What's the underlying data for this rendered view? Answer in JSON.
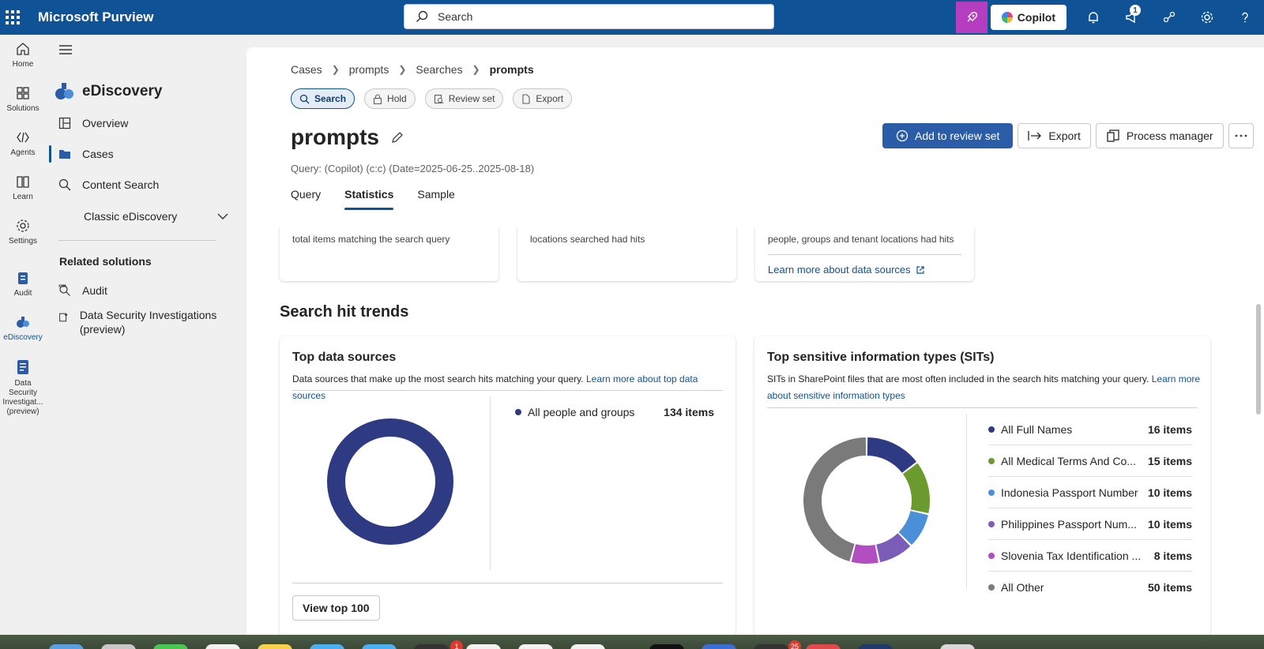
{
  "topbar": {
    "app_title": "Microsoft Purview",
    "search_placeholder": "Search",
    "copilot_label": "Copilot",
    "notification_count": "1"
  },
  "rail": {
    "items": [
      {
        "label": "Home",
        "icon": "home-icon"
      },
      {
        "label": "Solutions",
        "icon": "solutions-icon"
      },
      {
        "label": "Agents",
        "icon": "agents-icon"
      },
      {
        "label": "Learn",
        "icon": "learn-icon"
      },
      {
        "label": "Settings",
        "icon": "settings-icon"
      },
      {
        "label": "Audit",
        "icon": "audit-icon"
      },
      {
        "label": "eDiscovery",
        "icon": "ediscovery-icon"
      },
      {
        "label": "Data Security Investigat... (preview)",
        "icon": "dsi-icon"
      }
    ]
  },
  "subnav": {
    "header": "eDiscovery",
    "items": [
      {
        "label": "Overview"
      },
      {
        "label": "Cases"
      },
      {
        "label": "Content Search"
      },
      {
        "label": "Classic eDiscovery"
      }
    ],
    "related_title": "Related solutions",
    "related": [
      {
        "label": "Audit"
      },
      {
        "label": "Data Security Investigations (preview)"
      }
    ]
  },
  "breadcrumb": [
    "Cases",
    "prompts",
    "Searches",
    "prompts"
  ],
  "pills": [
    {
      "label": "Search",
      "active": true
    },
    {
      "label": "Hold"
    },
    {
      "label": "Review set"
    },
    {
      "label": "Export"
    }
  ],
  "page": {
    "title": "prompts",
    "query": "Query: (Copilot) (c:c) (Date=2025-06-25..2025-08-18)"
  },
  "actions": {
    "add_review": "Add to review set",
    "export": "Export",
    "process_manager": "Process manager"
  },
  "tabs": [
    "Query",
    "Statistics",
    "Sample"
  ],
  "stat_cards": {
    "items_text": "total items matching the search query",
    "locations_text": "locations searched had hits",
    "people_text": "people, groups and tenant locations had hits",
    "learn_more": "Learn more about data sources"
  },
  "section_title": "Search hit trends",
  "top_data_sources": {
    "title": "Top data sources",
    "desc": "Data sources that make up the most search hits matching your query.",
    "link": "Learn more about top data sources",
    "legend": [
      {
        "name": "All people and groups",
        "value": "134 items",
        "color": "#2e3a82"
      }
    ],
    "view_button": "View top 100"
  },
  "top_sits": {
    "title": "Top sensitive information types (SITs)",
    "desc": "SITs in SharePoint files that are most often included in the search hits matching your query.",
    "link_a": "Learn more",
    "link_b": "about sensitive information types",
    "legend": [
      {
        "name": "All Full Names",
        "value": "16 items",
        "color": "#2e3a82"
      },
      {
        "name": "All Medical Terms And Co...",
        "value": "15 items",
        "color": "#6b9a2e"
      },
      {
        "name": "Indonesia Passport Number",
        "value": "10 items",
        "color": "#4a8fd8"
      },
      {
        "name": "Philippines Passport Num...",
        "value": "10 items",
        "color": "#7b5cb8"
      },
      {
        "name": "Slovenia Tax Identification ...",
        "value": "8 items",
        "color": "#b34ec2"
      },
      {
        "name": "All Other",
        "value": "50 items",
        "color": "#7a7a7a"
      }
    ]
  },
  "chart_data": [
    {
      "type": "pie",
      "title": "Top data sources",
      "categories": [
        "All people and groups"
      ],
      "values": [
        134
      ]
    },
    {
      "type": "pie",
      "title": "Top sensitive information types (SITs)",
      "categories": [
        "All Full Names",
        "All Medical Terms And Co...",
        "Indonesia Passport Number",
        "Philippines Passport Num...",
        "Slovenia Tax Identification ...",
        "All Other"
      ],
      "values": [
        16,
        15,
        10,
        10,
        8,
        50
      ]
    }
  ],
  "dock": {
    "badge_a": "1",
    "badge_b": "25"
  }
}
